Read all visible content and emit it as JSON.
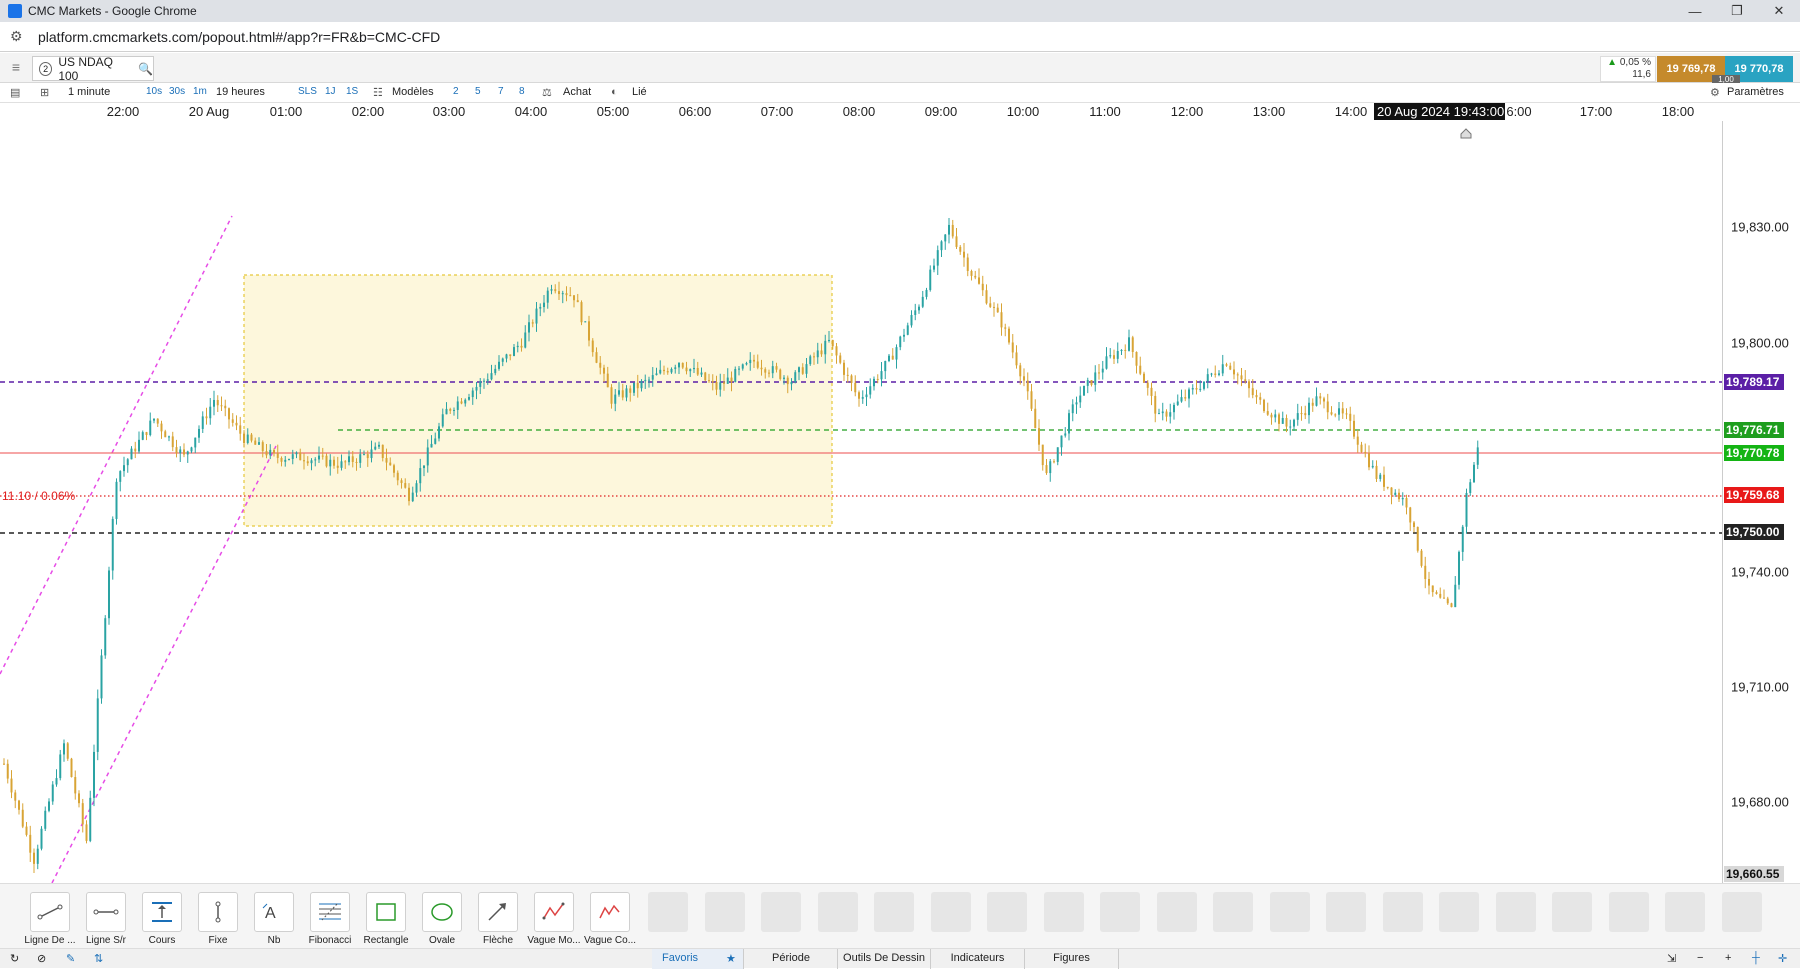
{
  "window": {
    "title": "CMC Markets - Google Chrome",
    "controls": [
      "—",
      "❐",
      "✕"
    ]
  },
  "browser": {
    "url": "platform.cmcmarkets.com/popout.html#/app?r=FR&b=CMC-CFD"
  },
  "instrument": {
    "index": "2",
    "name": "US NDAQ 100"
  },
  "quote": {
    "change_pct": "0,05 %",
    "change_pts": "11,6",
    "sell": "19 769,78",
    "buy": "19 770,78",
    "spread": "1,00"
  },
  "toolbar": {
    "interval": "1 minute",
    "fast_intervals": [
      "10s",
      "30s",
      "1m"
    ],
    "span": "19 heures",
    "period_buttons": [
      "SLS",
      "1J",
      "1S"
    ],
    "templates": "Modèles",
    "layout_buttons": [
      "2",
      "5",
      "7",
      "8"
    ],
    "buy": "Achat",
    "linked": "Lié",
    "settings": "Paramètres"
  },
  "time_axis": [
    "22:00",
    "20 Aug",
    "01:00",
    "02:00",
    "03:00",
    "04:00",
    "05:00",
    "06:00",
    "07:00",
    "08:00",
    "09:00",
    "10:00",
    "11:00",
    "12:00",
    "13:00",
    "14:00",
    "6:00",
    "17:00",
    "18:00"
  ],
  "cursor_time": "20 Aug 2024 19:43:00",
  "price_axis": [
    "19,830.00",
    "19,800.00",
    "19,740.00",
    "19,710.00",
    "19,680.00"
  ],
  "price_labels": {
    "purple": "19,789.17",
    "green_dash": "19,776.71",
    "current": "19,770.78",
    "red": "19,759.68",
    "black": "19,750.00",
    "low": "19,660.55"
  },
  "pct_label": "11.10 / 0.06%",
  "colors": {
    "purple": "#5b1fa6",
    "green": "#1e9e1e",
    "red": "#e02020",
    "black": "#222222",
    "up_candle": "#2aa3a3",
    "down_candle": "#d8a435"
  },
  "tools": [
    {
      "label": "Ligne De ...",
      "icon": "trend-line-icon"
    },
    {
      "label": "Ligne S/r",
      "icon": "sr-line-icon"
    },
    {
      "label": "Cours",
      "icon": "price-icon"
    },
    {
      "label": "Fixe",
      "icon": "fixed-icon"
    },
    {
      "label": "Nb",
      "icon": "text-icon"
    },
    {
      "label": "Fibonacci",
      "icon": "fibonacci-icon"
    },
    {
      "label": "Rectangle",
      "icon": "rectangle-icon"
    },
    {
      "label": "Ovale",
      "icon": "oval-icon"
    },
    {
      "label": "Flèche",
      "icon": "arrow-icon"
    },
    {
      "label": "Vague Mo...",
      "icon": "wave-icon"
    },
    {
      "label": "Vague Co...",
      "icon": "wave2-icon"
    }
  ],
  "bottom_tabs": [
    "Favoris",
    "Période",
    "Outils De Dessin",
    "Indicateurs",
    "Figures"
  ],
  "chart_data": {
    "type": "candlestick",
    "price_range": [
      19660.55,
      19850
    ],
    "start": "19 Aug 21:20",
    "end": "20 Aug 19:43",
    "keypoints": [
      [
        0,
        19690
      ],
      [
        8,
        19665
      ],
      [
        16,
        19695
      ],
      [
        22,
        19670
      ],
      [
        30,
        19765
      ],
      [
        40,
        19780
      ],
      [
        48,
        19770
      ],
      [
        56,
        19785
      ],
      [
        64,
        19775
      ],
      [
        72,
        19770
      ],
      [
        80,
        19770
      ],
      [
        90,
        19768
      ],
      [
        100,
        19772
      ],
      [
        108,
        19760
      ],
      [
        118,
        19782
      ],
      [
        128,
        19790
      ],
      [
        138,
        19800
      ],
      [
        146,
        19815
      ],
      [
        152,
        19812
      ],
      [
        162,
        19785
      ],
      [
        172,
        19790
      ],
      [
        180,
        19795
      ],
      [
        190,
        19788
      ],
      [
        200,
        19795
      ],
      [
        210,
        19790
      ],
      [
        220,
        19800
      ],
      [
        228,
        19785
      ],
      [
        236,
        19795
      ],
      [
        244,
        19810
      ],
      [
        252,
        19830
      ],
      [
        258,
        19818
      ],
      [
        266,
        19805
      ],
      [
        272,
        19790
      ],
      [
        278,
        19765
      ],
      [
        286,
        19785
      ],
      [
        294,
        19795
      ],
      [
        300,
        19800
      ],
      [
        308,
        19780
      ],
      [
        318,
        19788
      ],
      [
        326,
        19795
      ],
      [
        334,
        19785
      ],
      [
        342,
        19778
      ],
      [
        350,
        19785
      ],
      [
        358,
        19780
      ],
      [
        366,
        19765
      ],
      [
        374,
        19758
      ],
      [
        380,
        19735
      ],
      [
        386,
        19730
      ],
      [
        390,
        19760
      ],
      [
        393,
        19772
      ]
    ]
  }
}
